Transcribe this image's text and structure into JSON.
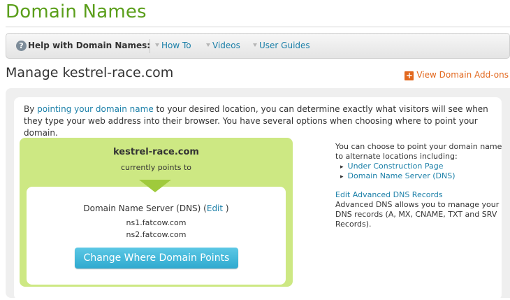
{
  "page": {
    "title": "Domain Names"
  },
  "helpbar": {
    "label": "Help with Domain Names:",
    "links": [
      "How To",
      "Videos",
      "User Guides"
    ]
  },
  "manage": {
    "title": "Manage kestrel-race.com",
    "addons_label": "View Domain Add-ons"
  },
  "intro": {
    "prefix": "By ",
    "link": "pointing your domain name",
    "suffix": " to your desired location, you can determine exactly what visitors will see when they type your web address into their browser. You have several options when choosing where to point your domain."
  },
  "pointing": {
    "domain": "kestrel-race.com",
    "currently": "currently points to",
    "target": "Domain Name Server (DNS)",
    "edit_open": " (",
    "edit_label": "Edit",
    "edit_close": " )",
    "nameservers": [
      "ns1.fatcow.com",
      "ns2.fatcow.com"
    ],
    "change_button": "Change Where Domain Points"
  },
  "sidebar": {
    "intro": "You can choose to point your domain name to alternate locations including:",
    "options": [
      "Under Construction Page",
      "Domain Name Server (DNS)"
    ],
    "advanced_link": "Edit Advanced DNS Records",
    "advanced_desc": "Advanced DNS allows you to manage your DNS records (A, MX, CNAME, TXT and SRV Records)."
  },
  "colors": {
    "brand_green": "#5a9e1a",
    "link_blue": "#1a7fa8",
    "accent_orange": "#e2681e",
    "panel_green": "#cde883"
  }
}
